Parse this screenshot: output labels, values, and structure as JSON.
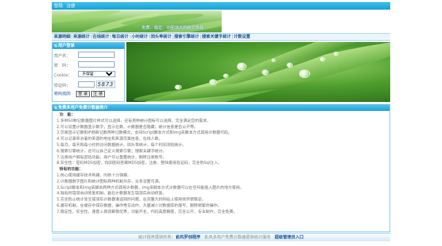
{
  "topbar": {
    "login": "登陆",
    "register": "注册"
  },
  "banner": {
    "slogan": "免费、稳定、功能强大的统计系统"
  },
  "nav": {
    "items": [
      "来源明细",
      "来源统计",
      "在线统计",
      "每日统计",
      "小时统计",
      "回头率统计",
      "搜索引擎统计",
      "搜索关键字统计",
      "计数设置"
    ],
    "separator": "|"
  },
  "login": {
    "title": "用户登录",
    "username_label": "用户名：",
    "username_value": "",
    "password_label": "密　码：",
    "password_value": "",
    "cookie_label": "Cookie：",
    "cookie_selected": "不保留",
    "captcha_label": "验证码：",
    "captcha_value": "",
    "captcha_code": "5873",
    "forgot_link": "密码找回",
    "login_button": "登 录",
    "register_button": "注 册"
  },
  "info": {
    "title": "免费多用户免费计数器简介",
    "functions_heading": "功　能：",
    "functions": [
      "1.多种50种记数器图片样式可以选择，还有两种统计图标可以选择，完全满足您的需求。",
      "2.可以设置计数器显示数字，显示位数，计数器是否隐藏，统计信息是否公开等。",
      "3.页面显示记数和IP刷新记数两种记数模式，支持Script脚本方式和img亲脚本方式调用计数器代码。",
      "4.可以记录来访者的来源的地址和来源页面信息，在线人数。",
      "5.每月、每天和每小时的访问数据统计，回头率统计，每个时间流短统计。",
      "6.搜索引擎统计，还可以自己定义搜索引擎；搜索关键字统计。",
      "7.注册用户拥有密码功能，用户可以重置统计，删除注册账号。",
      "8.安全性：密码MD5加密，找回密码答案MD5加密，注册、登陆使用验证码，完全防Sql注入。"
    ],
    "features_heading": "特有的功能：",
    "features": [
      "1.核心使用缓存技术构建，内核十分强健。",
      "2.计数器数字图片和统计图标两种机制共存，众多设置可调。",
      "3.Script脚本和img亲脚本两种方式调用计数器，img亲脚本方式计数器可以在任何能插入图片的地方使用。",
      "4.独有的错误自动修复机制，能在计数器发生错误后自动修复。",
      "5.完全防止统计发生错误后计数器清返回的问题，在流量大的网站上使用依然很稳定。",
      "6.缓存机制，在缓存中保存数据，操作常见动作，大量减少对数据库的增写，删除频繁的操作。",
      "7.稳定性、安全性、速度上表现都很优秀，功能齐全，代码高度精度，完全公开，专业制作，完全免费。"
    ]
  },
  "footer": {
    "prefix": "统计程序提供所有：",
    "owner": "俞风罗创程序",
    "middle": "俞风多用户免费计数器提供统计服务",
    "admin_link": "超级管理员入口"
  },
  "colors": {
    "accent": "#1a9fd6",
    "nav_text": "#1d4f8c",
    "link": "#1a5aa8"
  }
}
